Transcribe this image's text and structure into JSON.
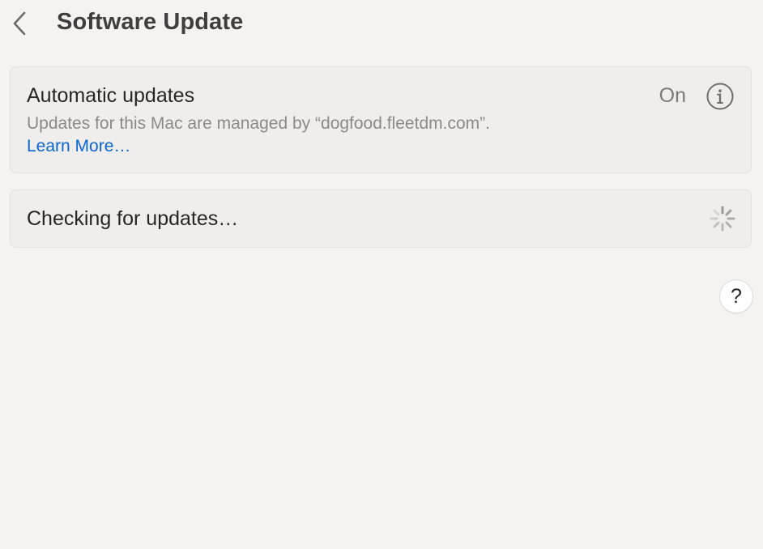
{
  "header": {
    "title": "Software Update",
    "back_icon": "chevron-left-icon"
  },
  "automatic_updates": {
    "title": "Automatic updates",
    "status": "On",
    "description": "Updates for this Mac are managed by “dogfood.fleetdm.com”.",
    "link": "Learn More…",
    "info_icon": "info-icon"
  },
  "check": {
    "label": "Checking for updates…",
    "spinner_icon": "spinner-icon"
  },
  "help": {
    "label": "?"
  },
  "colors": {
    "background": "#f4f3f2",
    "card": "#efeeed",
    "link": "#0a66d4",
    "secondary_text": "#8a8a8a"
  }
}
